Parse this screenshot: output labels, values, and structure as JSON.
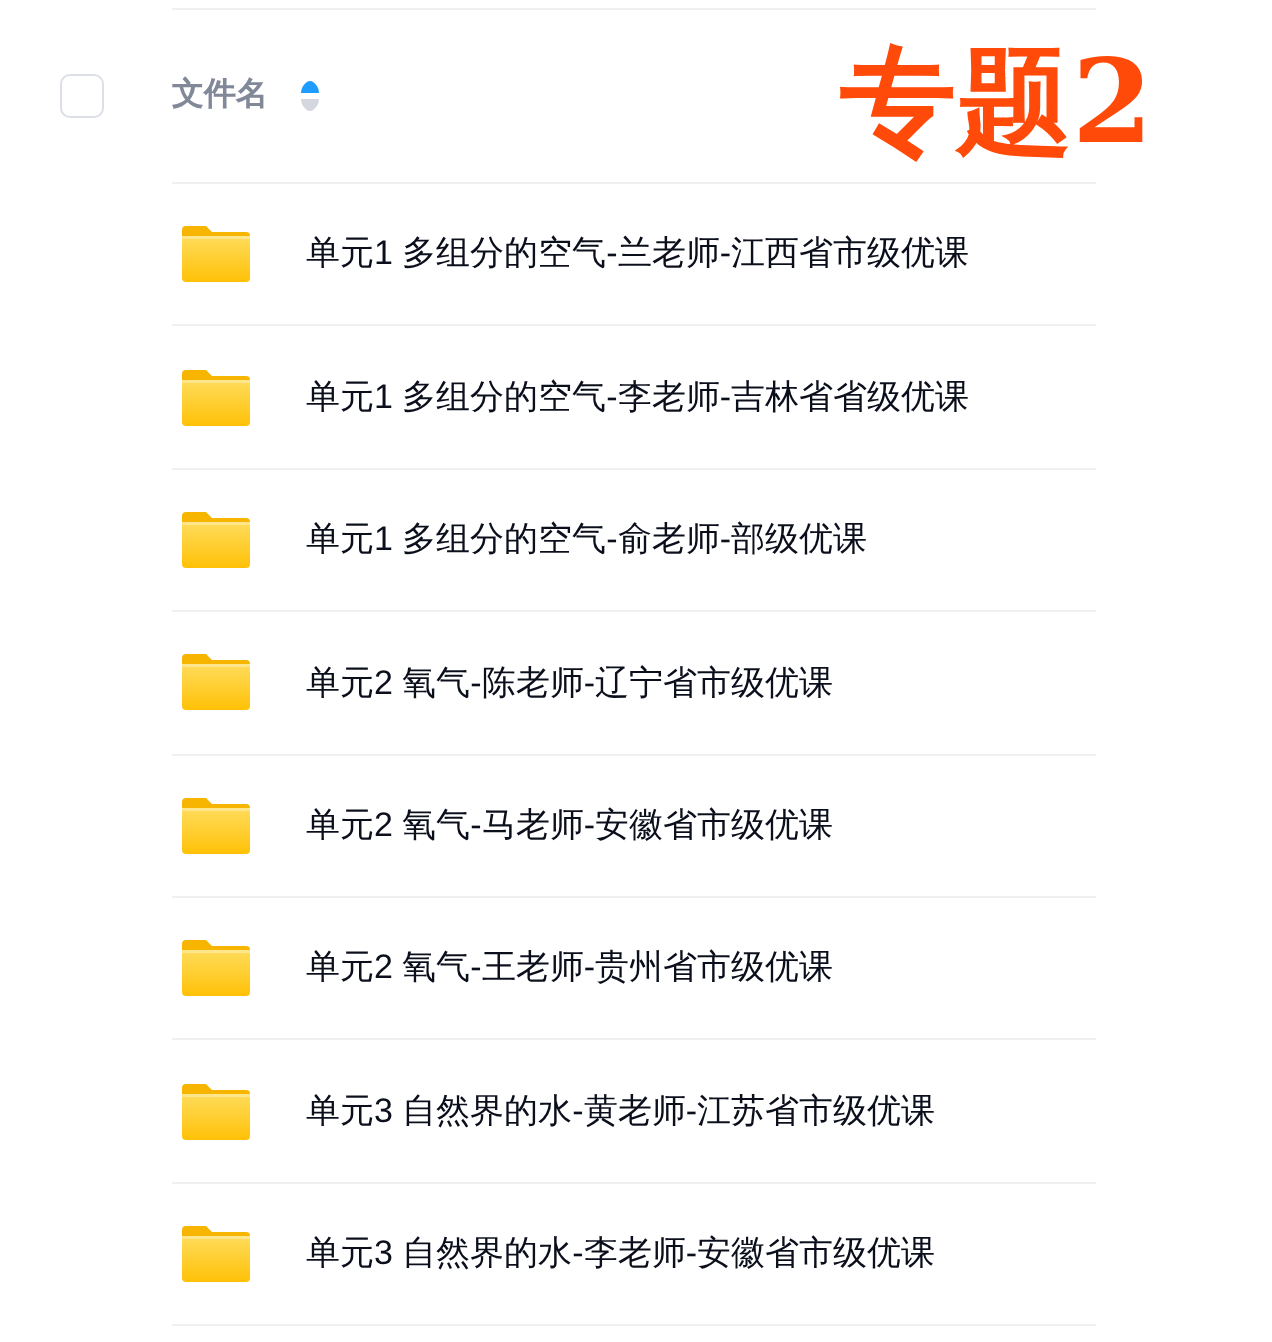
{
  "overlay_label": "专题2",
  "header": {
    "select_all": {
      "checked": false
    },
    "column": {
      "label": "文件名",
      "sort_ascending": true
    }
  },
  "files": [
    {
      "name": "单元1 多组分的空气-兰老师-江西省市级优课"
    },
    {
      "name": "单元1 多组分的空气-李老师-吉林省省级优课"
    },
    {
      "name": "单元1 多组分的空气-俞老师-部级优课"
    },
    {
      "name": "单元2 氧气-陈老师-辽宁省市级优课"
    },
    {
      "name": "单元2 氧气-马老师-安徽省市级优课"
    },
    {
      "name": "单元2 氧气-王老师-贵州省市级优课"
    },
    {
      "name": "单元3 自然界的水-黄老师-江苏省市级优课"
    },
    {
      "name": "单元3 自然界的水-李老师-安徽省市级优课"
    }
  ]
}
